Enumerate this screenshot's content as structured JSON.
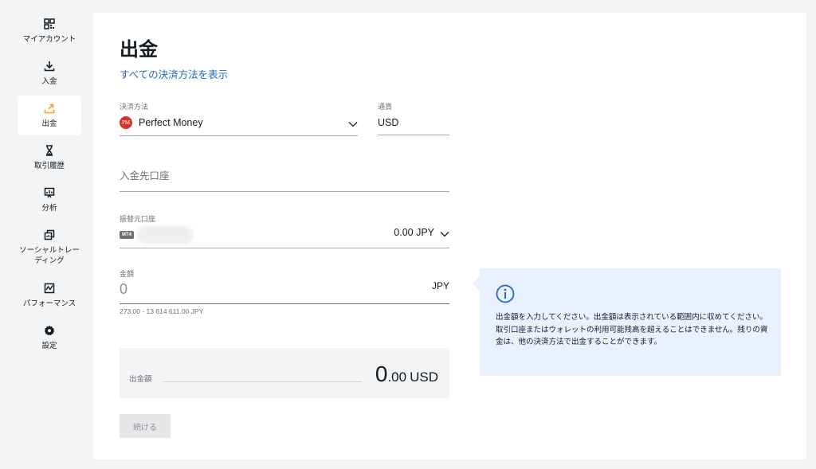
{
  "sidebar": {
    "items": [
      {
        "label": "マイアカウント",
        "icon": "qr-grid-icon"
      },
      {
        "label": "入金",
        "icon": "download-icon"
      },
      {
        "label": "出金",
        "icon": "upload-icon"
      },
      {
        "label": "取引履歴",
        "icon": "hourglass-icon"
      },
      {
        "label": "分析",
        "icon": "analytics-icon"
      },
      {
        "label": "ソーシャルトレーディング",
        "icon": "copy-icon"
      },
      {
        "label": "パフォーマンス",
        "icon": "performance-chart-icon"
      },
      {
        "label": "設定",
        "icon": "gear-icon"
      }
    ],
    "active_index": 2,
    "accent_color": "#f5a623"
  },
  "page": {
    "title": "出金",
    "all_methods_link": "すべての決済方法を表示"
  },
  "form": {
    "method": {
      "label": "決済方法",
      "value": "Perfect Money",
      "logo_text": "PM"
    },
    "currency": {
      "label": "通貨",
      "value": "USD"
    },
    "deposit_account": {
      "placeholder": "入金先口座"
    },
    "from_account": {
      "label": "振替元口座",
      "badge": "MT4",
      "balance": "0.00 JPY"
    },
    "amount": {
      "label": "金額",
      "value": "0",
      "unit": "JPY",
      "range": "273.00 - 13 614 611.00 JPY"
    }
  },
  "summary": {
    "label": "出金額",
    "amount_int": "0",
    "amount_dec": ".00",
    "currency": "USD"
  },
  "continue_button": "続ける",
  "info": {
    "text": "出金額を入力してください。出金額は表示されている範囲内に収めてください。取引口座またはウォレットの利用可能残高を超えることはできません。残りの資金は、他の決済方法で出金することができます。"
  },
  "colors": {
    "link": "#2168c7",
    "info_bg": "#e8f1fd",
    "pm_red": "#d6342b"
  }
}
